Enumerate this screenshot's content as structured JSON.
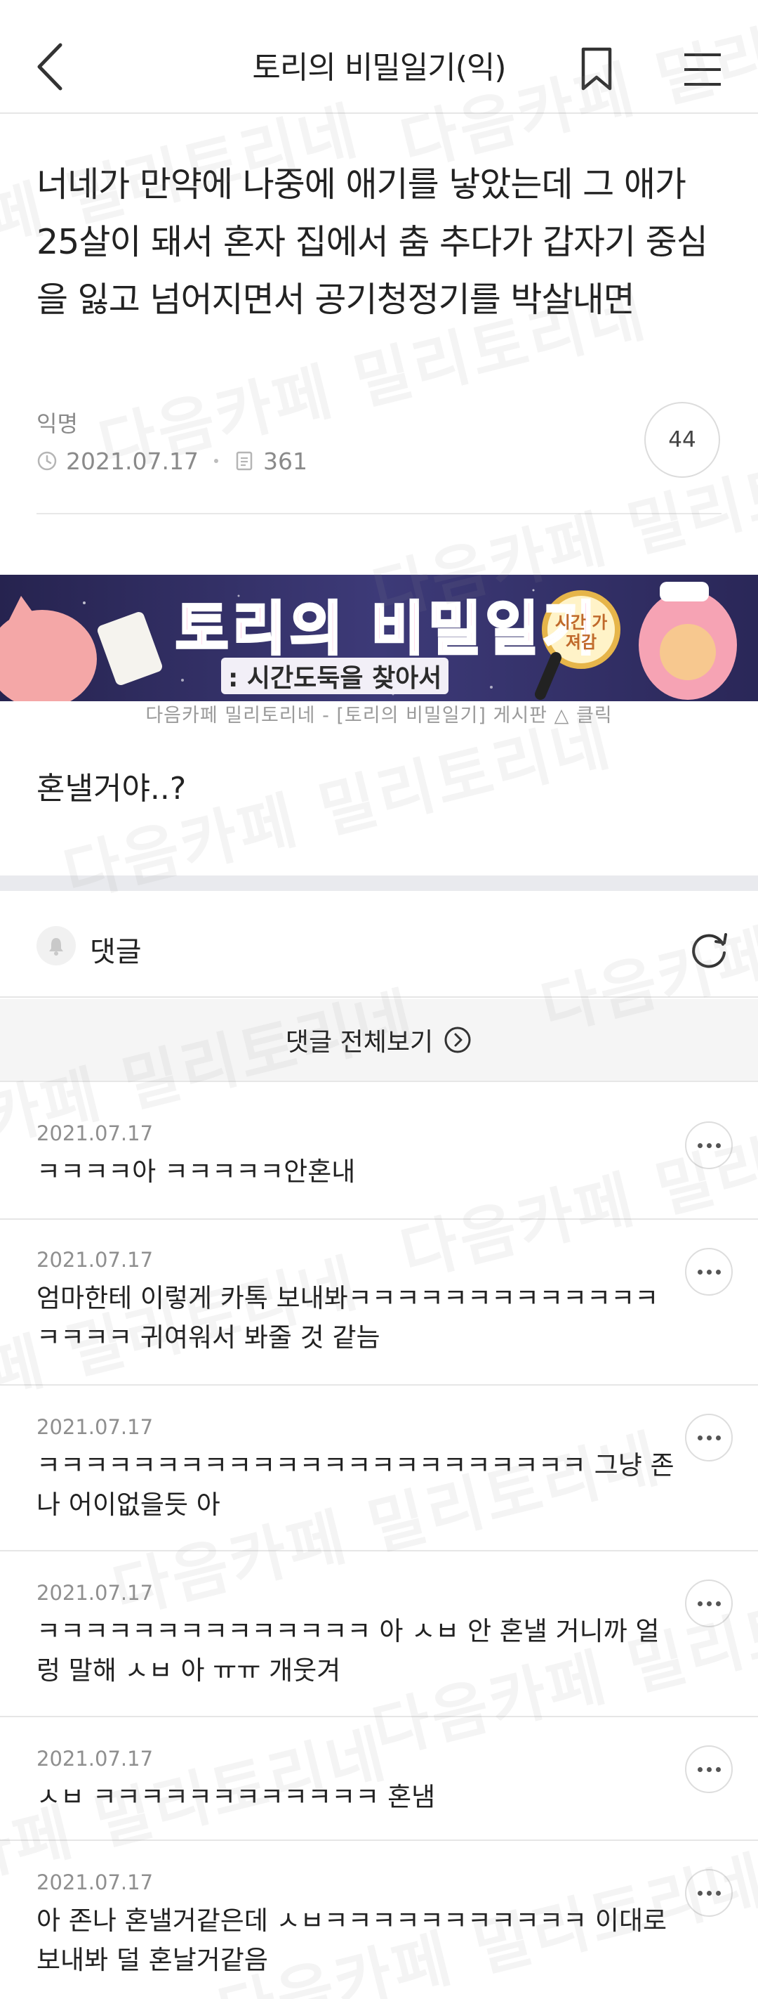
{
  "header": {
    "title": "토리의 비밀일기(익)"
  },
  "post": {
    "title": "너네가 만약에 나중에 애기를 낳았는데 그 애가 25살이 돼서 혼자 집에서 춤 추다가 갑자기 중심을 잃고 넘어지면서 공기청정기를 박살내면",
    "author": "익명",
    "date": "2021.07.17",
    "views": "361",
    "comment_count": "44",
    "banner": {
      "title": "토리의 비밀일기",
      "subtitle": ": 시간도둑을 찾아서",
      "badge": "시간 가져감",
      "caption": "다음카페 밀리토리네 - [토리의 비밀일기] 게시판 △ 클릭"
    },
    "body": "혼낼거야..?"
  },
  "comments_section": {
    "label": "댓글",
    "view_all": "댓글 전체보기",
    "items": [
      {
        "date": "2021.07.17",
        "text": "ㅋㅋㅋㅋ아 ㅋㅋㅋㅋㅋ안혼내"
      },
      {
        "date": "2021.07.17",
        "text": "엄마한테 이렇게 카톡 보내봐ㅋㅋㅋㅋㅋㅋㅋㅋㅋㅋㅋㅋㅋ ㅋㅋㅋㅋ 귀여워서 봐줄 것 같늠"
      },
      {
        "date": "2021.07.17",
        "text": "ㅋㅋㅋㅋㅋㅋㅋㅋㅋㅋㅋㅋㅋㅋㅋㅋㅋㅋㅋㅋㅋㅋㅋ 그냥 존나 어이없을듯 아"
      },
      {
        "date": "2021.07.17",
        "text": "ㅋㅋㅋㅋㅋㅋㅋㅋㅋㅋㅋㅋㅋㅋ 아 ㅅㅂ 안 혼낼 거니까 얼렁 말해 ㅅㅂ 아 ㅠㅠ 개웃겨"
      },
      {
        "date": "2021.07.17",
        "text": "ㅅㅂ ㅋㅋㅋㅋㅋㅋㅋㅋㅋㅋㅋㅋ 혼냄"
      },
      {
        "date": "2021.07.17",
        "text": "아 존나 혼낼거같은데 ㅅㅂㅋㅋㅋㅋㅋㅋㅋㅋㅋㅋㅋ 이대로 보내봐 덜 혼날거같음"
      }
    ]
  },
  "watermark": {
    "text": "다음카페 밀리토리네"
  },
  "colors": {
    "text": "#222222",
    "muted": "#8a8a8a",
    "divider": "#e6e6e6",
    "section_gap": "#e9eaee",
    "banner_bg": "#3a3670",
    "banner_title": "#ff5fa2"
  },
  "icons": [
    "back-arrow-icon",
    "bookmark-icon",
    "menu-icon",
    "clock-icon",
    "document-icon",
    "bell-icon",
    "refresh-icon",
    "circle-arrow-icon",
    "more-icon"
  ]
}
